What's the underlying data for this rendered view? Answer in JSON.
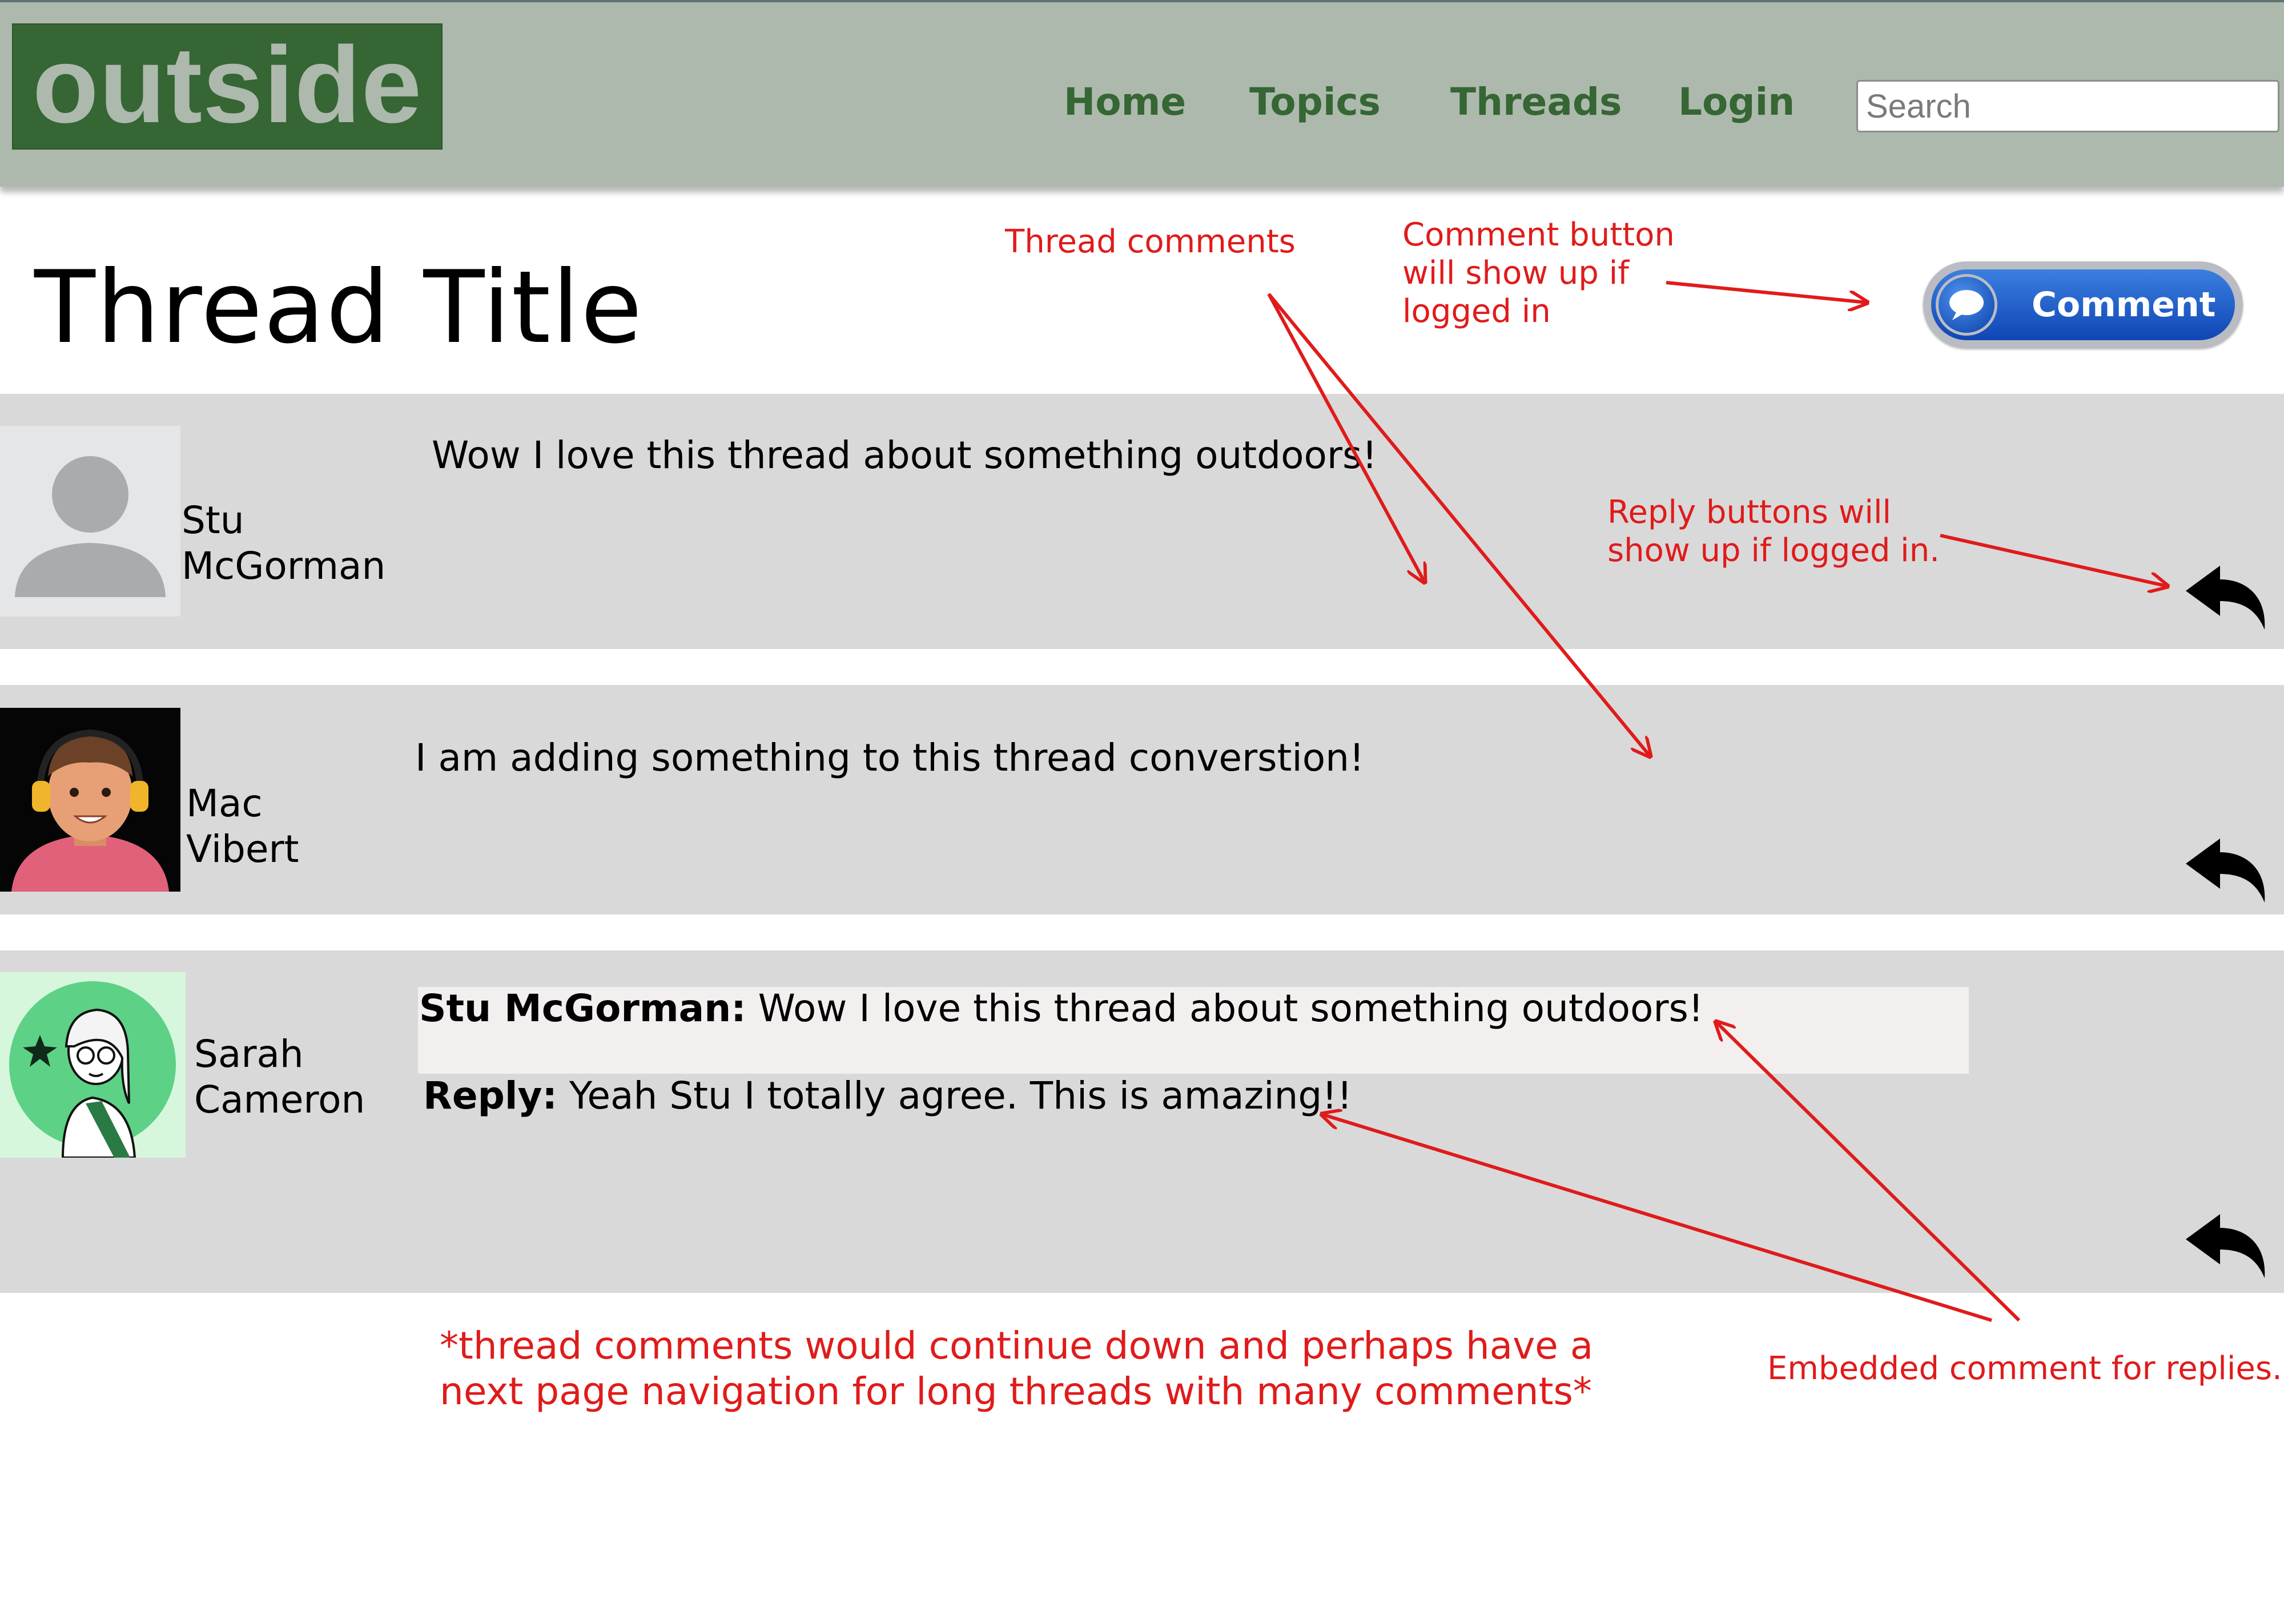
{
  "header": {
    "logo": "outside",
    "nav": [
      "Home",
      "Topics",
      "Threads",
      "Login"
    ],
    "search_placeholder": "Search"
  },
  "page": {
    "title": "Thread Title",
    "comment_button_label": "Comment"
  },
  "comments": [
    {
      "author_first": "Stu",
      "author_last": "McGorman",
      "text": "Wow I love this thread about something outdoors!"
    },
    {
      "author_first": "Mac",
      "author_last": "Vibert",
      "text": "I am adding something to this thread converstion!"
    },
    {
      "author_first": "Sarah",
      "author_last": "Cameron",
      "embedded_author": "Stu McGorman:",
      "embedded_text": "Wow I love this thread about something outdoors!",
      "reply_label": "Reply:",
      "reply_text": "Yeah Stu I totally agree. This is amazing!!"
    }
  ],
  "annotations": {
    "thread_comments": "Thread comments",
    "comment_button_note": [
      "Comment button",
      "will show up if",
      "logged in"
    ],
    "reply_buttons_note": [
      "Reply buttons will",
      "show up if logged in."
    ],
    "continue_note": [
      "*thread comments would continue down and perhaps have a",
      "next page navigation for long threads with many comments*"
    ],
    "embedded_note": "Embedded comment for replies."
  },
  "colors": {
    "header_bg": "#adb9ad",
    "brand_green": "#356634",
    "row_bg": "#d9d9d9",
    "annotation_red": "#e01b1b",
    "comment_button_blue": "#1a58c8"
  }
}
